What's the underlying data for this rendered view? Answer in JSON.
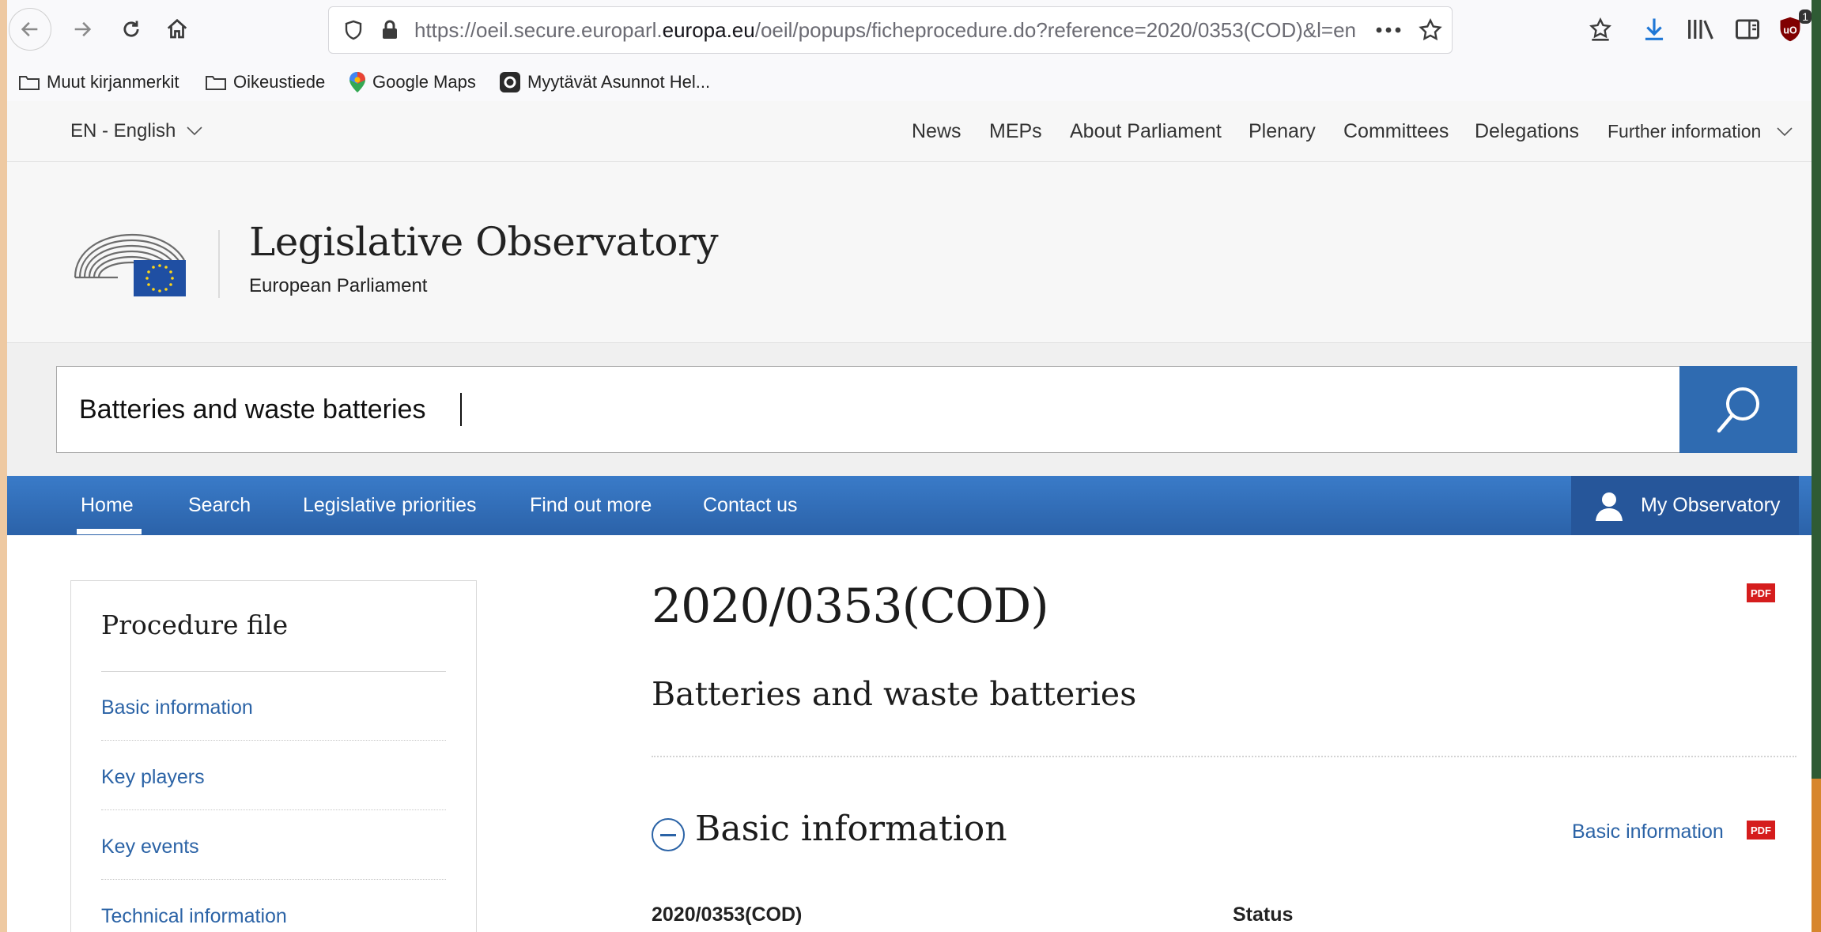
{
  "browser": {
    "url_prefix": "https://oeil.secure.europarl.",
    "url_domain": "europa.eu",
    "url_suffix": "/oeil/popups/ficheprocedure.do?reference=2020/0353(COD)&l=en",
    "ublock_count": "1"
  },
  "bookmarks": [
    {
      "label": "Muut kirjanmerkit",
      "icon": "folder-icon"
    },
    {
      "label": "Oikeustiede",
      "icon": "folder-icon"
    },
    {
      "label": "Google Maps",
      "icon": "map-pin-icon"
    },
    {
      "label": "Myytävät Asunnot Hel...",
      "icon": "site-favicon-icon"
    }
  ],
  "ep_top": {
    "language": "EN - English",
    "nav": [
      "News",
      "MEPs",
      "About Parliament",
      "Plenary",
      "Committees",
      "Delegations",
      "Further information"
    ]
  },
  "header": {
    "title": "Legislative Observatory",
    "subtitle": "European Parliament"
  },
  "search": {
    "value": "Batteries and waste batteries"
  },
  "main_nav": {
    "items": [
      "Home",
      "Search",
      "Legislative priorities",
      "Find out more",
      "Contact us"
    ],
    "active": "Home",
    "my_observatory": "My Observatory"
  },
  "sidebar": {
    "title": "Procedure file",
    "links": [
      "Basic information",
      "Key players",
      "Key events",
      "Technical information"
    ]
  },
  "procedure": {
    "reference": "2020/0353(COD)",
    "title": "Batteries and waste batteries",
    "pdf_label": "PDF",
    "section_title": "Basic information",
    "section_link": "Basic information",
    "ref_label": "2020/0353(COD)",
    "status_label": "Status"
  },
  "colors": {
    "brand_blue": "#2f6bb1",
    "link_blue": "#2b63a6",
    "pdf_red": "#d51d1d"
  }
}
